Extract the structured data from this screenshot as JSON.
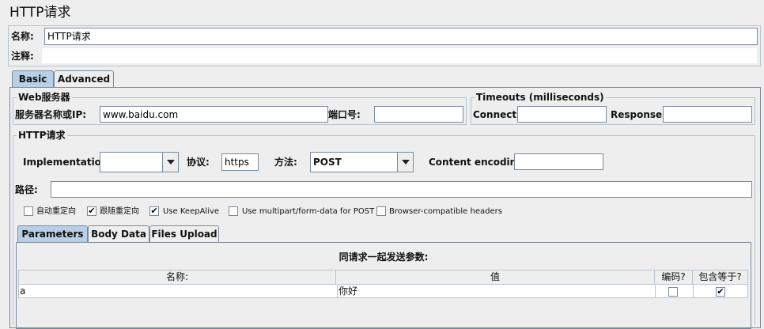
{
  "header": {
    "title": "HTTP请求"
  },
  "name_row": {
    "label": "名称:",
    "value": "HTTP请求"
  },
  "comment_row": {
    "label": "注释:",
    "value": ""
  },
  "main_tabs": [
    {
      "label": "Basic",
      "active": true
    },
    {
      "label": "Advanced",
      "active": false
    }
  ],
  "web_server": {
    "title": "Web服务器",
    "server_label": "服务器名称或IP:",
    "server_value": "www.baidu.com",
    "port_label": "端口号:",
    "port_value": ""
  },
  "timeouts": {
    "title": "Timeouts (milliseconds)",
    "connect_label": "Connect:",
    "connect_value": "",
    "response_label": "Response:",
    "response_value": ""
  },
  "http_request": {
    "title": "HTTP请求",
    "implementation_label": "Implementation:",
    "implementation_value": "",
    "protocol_label": "协议:",
    "protocol_value": "https",
    "method_label": "方法:",
    "method_value": "POST",
    "encoding_label": "Content encoding:",
    "encoding_value": "",
    "path_label": "路径:",
    "path_value": ""
  },
  "options": [
    {
      "label": "自动重定向",
      "checked": false
    },
    {
      "label": "跟随重定向",
      "checked": true
    },
    {
      "label": "Use KeepAlive",
      "checked": true
    },
    {
      "label": "Use multipart/form-data for POST",
      "checked": false
    },
    {
      "label": "Browser-compatible headers",
      "checked": false
    }
  ],
  "sub_tabs": [
    {
      "label": "Parameters",
      "active": true
    },
    {
      "label": "Body Data",
      "active": false
    },
    {
      "label": "Files Upload",
      "active": false
    }
  ],
  "params": {
    "caption": "同请求一起发送参数:",
    "columns": [
      "名称:",
      "值",
      "编码?",
      "包含等于?"
    ],
    "rows": [
      {
        "name": "a",
        "value": "你好",
        "encode": false,
        "include_equals": true
      }
    ]
  },
  "glyphs": {
    "check": "✔"
  }
}
